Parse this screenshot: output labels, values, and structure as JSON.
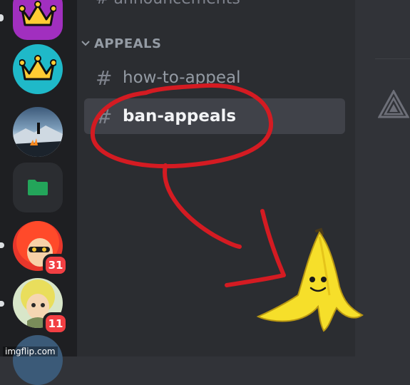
{
  "category": {
    "label": "APPEALS",
    "chevron_icon": "chevron-down-icon"
  },
  "channels_partial": "announcements",
  "channels": [
    {
      "label": "how-to-appeal",
      "icon": "hash-icon"
    },
    {
      "label": "ban-appeals",
      "icon": "hash-icon",
      "selected": true
    }
  ],
  "servers": [
    {
      "name": "crown-server-purple",
      "icon": "crown-icon",
      "color": "#a12fbf"
    },
    {
      "name": "crown-server-teal",
      "icon": "crown-icon",
      "color": "#1fb9c9"
    },
    {
      "name": "night-campfire-server",
      "icon": "landscape-image"
    },
    {
      "name": "folder",
      "icon": "folder-icon",
      "color": "#23a55a"
    },
    {
      "name": "red-hair-avatar-server",
      "badge": "31"
    },
    {
      "name": "yellow-hair-avatar-server",
      "badge": "11"
    },
    {
      "name": "blue-server"
    }
  ],
  "colors": {
    "rail_bg": "#1e1f22",
    "channel_bg": "#2b2d31",
    "main_bg": "#313338",
    "selected_bg": "#404249",
    "badge": "#f23f43",
    "annotation": "#d41b22"
  },
  "watermark": "imgflip.com"
}
